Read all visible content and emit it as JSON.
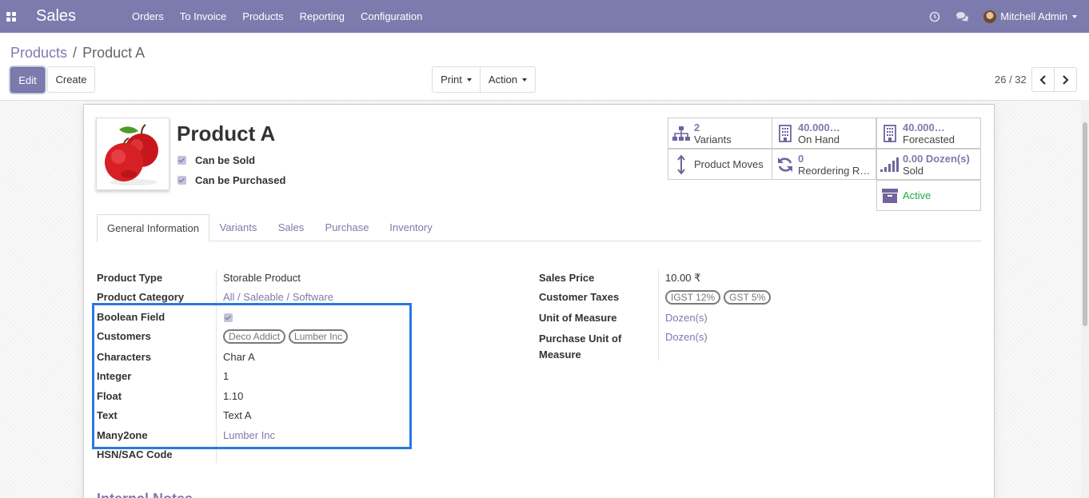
{
  "navbar": {
    "app_name": "Sales",
    "menu": [
      "Orders",
      "To Invoice",
      "Products",
      "Reporting",
      "Configuration"
    ],
    "user": "Mitchell Admin",
    "icons": [
      "apps-icon",
      "clock-icon",
      "chat-icon"
    ]
  },
  "breadcrumb": {
    "parent": "Products",
    "separator": "/",
    "current": "Product A"
  },
  "buttons": {
    "edit": "Edit",
    "create": "Create",
    "print": "Print",
    "action": "Action"
  },
  "pager": {
    "value": "26 / 32"
  },
  "product": {
    "name": "Product A",
    "can_be_sold": "Can be Sold",
    "can_be_purchased": "Can be Purchased"
  },
  "smart_buttons": {
    "variants": {
      "value": "2",
      "label": "Variants"
    },
    "on_hand": {
      "value": "40.000…",
      "label": "On Hand"
    },
    "forecasted": {
      "value": "40.000…",
      "label": "Forecasted"
    },
    "product_moves": {
      "label": "Product Moves"
    },
    "reordering": {
      "value": "0",
      "label": "Reordering R…"
    },
    "sold": {
      "value": "0.00 Dozen(s)",
      "label": "Sold"
    },
    "active": {
      "label": "Active"
    }
  },
  "tabs": [
    "General Information",
    "Variants",
    "Sales",
    "Purchase",
    "Inventory"
  ],
  "left_fields": {
    "product_type": {
      "label": "Product Type",
      "value": "Storable Product"
    },
    "product_category": {
      "label": "Product Category",
      "value": "All / Saleable / Software"
    },
    "boolean_field": {
      "label": "Boolean Field"
    },
    "customers": {
      "label": "Customers",
      "tags": [
        "Deco Addict",
        "Lumber Inc"
      ]
    },
    "characters": {
      "label": "Characters",
      "value": "Char A"
    },
    "integer": {
      "label": "Integer",
      "value": "1"
    },
    "float": {
      "label": "Float",
      "value": "1.10"
    },
    "text": {
      "label": "Text",
      "value": "Text A"
    },
    "many2one": {
      "label": "Many2one",
      "value": "Lumber Inc"
    },
    "hsn": {
      "label": "HSN/SAC Code"
    }
  },
  "right_fields": {
    "sales_price": {
      "label": "Sales Price",
      "value": "10.00 ₹"
    },
    "customer_taxes": {
      "label": "Customer Taxes",
      "tags": [
        "IGST 12%",
        "GST 5%"
      ]
    },
    "uom": {
      "label": "Unit of Measure",
      "value": "Dozen(s)"
    },
    "purchase_uom": {
      "label_line1": "Purchase Unit of",
      "label_line2": "Measure",
      "value": "Dozen(s)"
    }
  },
  "next_section": "Internal Notes",
  "colors": {
    "navbar": "#7c7bad",
    "link": "#7c7bad",
    "active_green": "#28a745",
    "highlight_box": "#2979e2"
  }
}
